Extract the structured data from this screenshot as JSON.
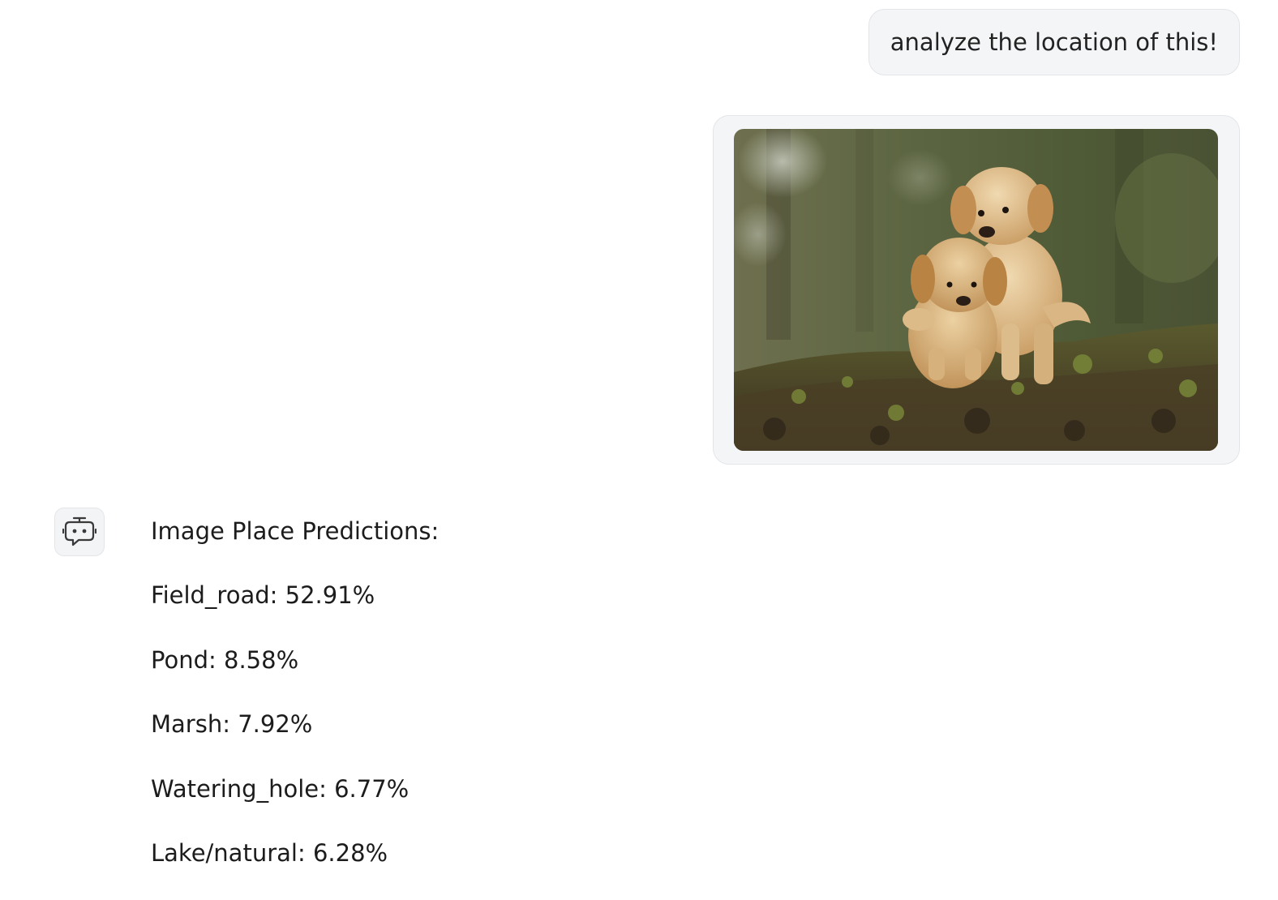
{
  "user_message": {
    "text": "analyze the location of this!"
  },
  "bot_message": {
    "title": "Image Place Predictions:",
    "predictions": [
      {
        "label": "Field_road",
        "value": "52.91%"
      },
      {
        "label": "Pond",
        "value": "8.58%"
      },
      {
        "label": "Marsh",
        "value": "7.92%"
      },
      {
        "label": "Watering_hole",
        "value": "6.77%"
      },
      {
        "label": "Lake/natural",
        "value": "6.28%"
      }
    ]
  },
  "icons": {
    "bot_avatar": "robot-chat-icon"
  }
}
